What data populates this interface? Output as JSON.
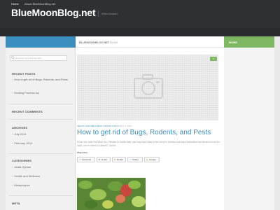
{
  "header": {
    "site_title": "BlueMoonBlog.net",
    "tagline": "Who Knows?"
  },
  "nav": {
    "items": [
      "Home",
      "About BlueMoonBlog.net"
    ]
  },
  "sidebar_right": {
    "label": "MORE"
  },
  "sidebar_left": {
    "search_placeholder": "To search type and hit enter",
    "recent_posts": {
      "title": "RECENT POSTS",
      "items": [
        "How to get rid of Bugs, Rodents, and Pests",
        "Healing Process Icy"
      ]
    },
    "recent_comments": {
      "title": "RECENT COMMENTS"
    },
    "archives": {
      "title": "ARCHIVES",
      "items": [
        "July 2014",
        "February 2014"
      ]
    },
    "categories": {
      "title": "CATEGORIES",
      "items": [
        "Acala Hyman",
        "Health and Wellness",
        "Metaphysics"
      ]
    },
    "meta": {
      "title": "META"
    }
  },
  "main": {
    "header_site": "BLUEMOONBLOG.NET",
    "header_suffix": "BLOG",
    "post": {
      "comment_count": "0",
      "categories": "HEALTH AND WELLNESS / METAPHYSICS",
      "date": "JULY 1, 2014",
      "title": "How to get rid of Bugs, Rodents, and Pests",
      "excerpt": "Some who read this follow the Christian or Jewish faith, and may have heard of the verse in Genesis that says humankind has dominion over the earth, and is called to subdue it. Others …",
      "share_label": "Share this:",
      "share_buttons": [
        "Facebook",
        "Email",
        "Reddit",
        "Twitter",
        "Google"
      ]
    }
  },
  "colors": {
    "accent_blue": "#3b8dbd",
    "accent_green": "#80b762",
    "header_bg": "#2f3034"
  }
}
